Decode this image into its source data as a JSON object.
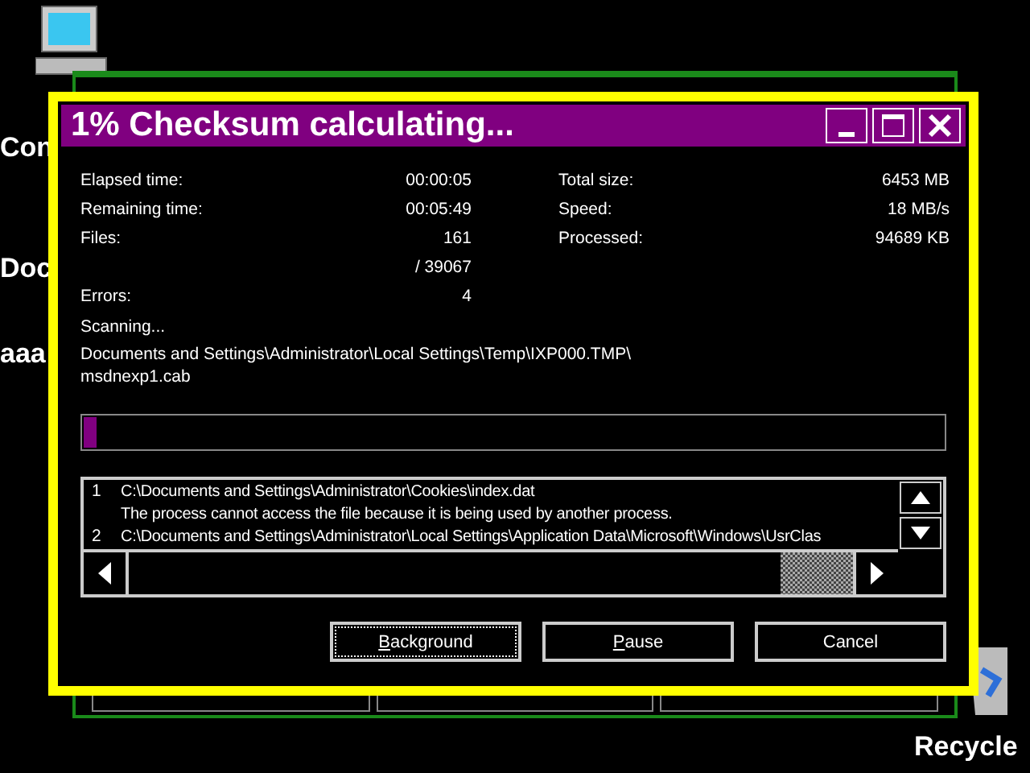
{
  "desktop": {
    "icons": [
      {
        "label": "Con"
      },
      {
        "label": "Doc"
      },
      {
        "label": "aaa"
      },
      {
        "label": "Recycle"
      }
    ]
  },
  "dialog": {
    "title": "1% Checksum calculating...",
    "stats_left": [
      {
        "label": "Elapsed time:",
        "value": "00:00:05"
      },
      {
        "label": "Remaining time:",
        "value": "00:05:49"
      },
      {
        "label": "Files:",
        "value": "161"
      },
      {
        "value": "/ 39067"
      },
      {
        "label": "Errors:",
        "value": "4"
      }
    ],
    "stats_right": [
      {
        "label": "Total size:",
        "value": "6453 MB"
      },
      {
        "label": "Speed:",
        "value": "18 MB/s"
      },
      {
        "label": "Processed:",
        "value": "94689 KB"
      }
    ],
    "status": "Scanning...",
    "path": "Documents and Settings\\Administrator\\Local Settings\\Temp\\IXP000.TMP\\",
    "file": "msdnexp1.cab",
    "progress": {
      "level": 0.015
    },
    "log": [
      {
        "number": "1",
        "text": "C:\\Documents and Settings\\Administrator\\Cookies\\index.dat"
      },
      {
        "text": "The process cannot access the file because it is being used by another process."
      },
      {
        "number": "2",
        "text": "C:\\Documents and Settings\\Administrator\\Local Settings\\Application Data\\Microsoft\\Windows\\UsrClas"
      }
    ],
    "buttons": [
      {
        "label": "Background",
        "first_letter_underlined": true,
        "focused": true
      },
      {
        "label": "Pause",
        "first_letter_underlined": true,
        "focused": false
      },
      {
        "label": "Cancel",
        "first_letter_underlined": false,
        "focused": false
      }
    ]
  }
}
